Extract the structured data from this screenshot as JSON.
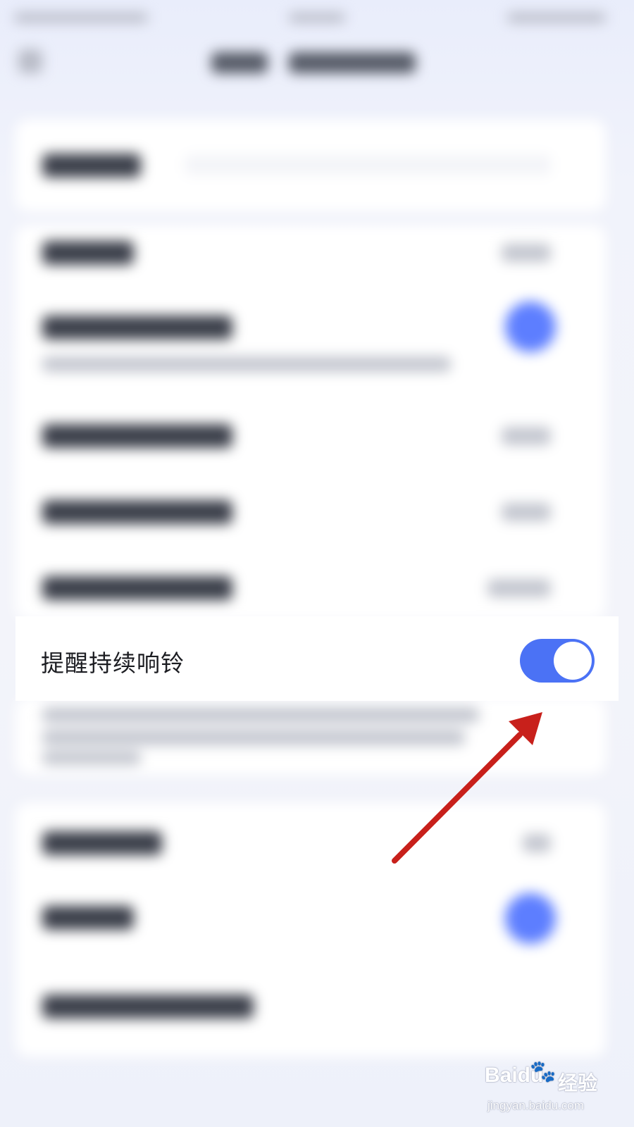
{
  "setting_row": {
    "label": "提醒持续响铃",
    "toggle_on": true
  },
  "colors": {
    "accent": "#4b72f5",
    "arrow": "#c8201b"
  },
  "watermark": {
    "logo": "Baidu",
    "paw": "🐾",
    "chinese": "经验",
    "url": "jingyan.baidu.com"
  }
}
